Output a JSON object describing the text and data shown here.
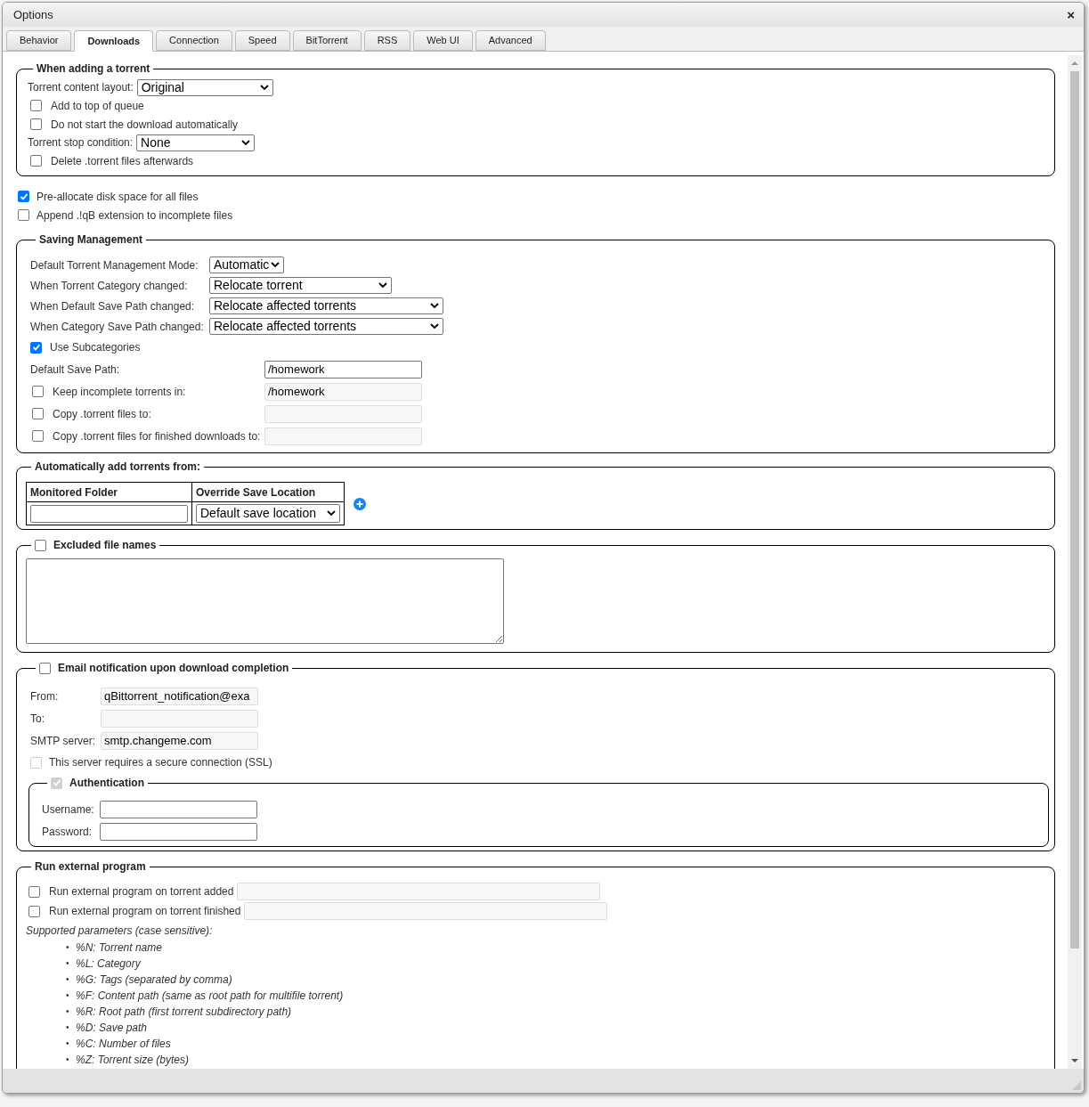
{
  "window": {
    "title": "Options",
    "close": "×"
  },
  "tabs": [
    {
      "label": "Behavior",
      "selected": false
    },
    {
      "label": "Downloads",
      "selected": true
    },
    {
      "label": "Connection",
      "selected": false
    },
    {
      "label": "Speed",
      "selected": false
    },
    {
      "label": "BitTorrent",
      "selected": false
    },
    {
      "label": "RSS",
      "selected": false
    },
    {
      "label": "Web UI",
      "selected": false
    },
    {
      "label": "Advanced",
      "selected": false
    }
  ],
  "adding": {
    "legend": "When adding a torrent",
    "rows": [
      {
        "kind": "select",
        "label": "Torrent content layout:",
        "value": "Original"
      },
      {
        "kind": "checkbox",
        "label": "Add to top of queue",
        "checked": false
      },
      {
        "kind": "checkbox",
        "label": "Do not start the download automatically",
        "checked": false
      },
      {
        "kind": "select",
        "label": "Torrent stop condition:",
        "value": "None"
      },
      {
        "kind": "checkbox",
        "label": "Delete .torrent files afterwards",
        "checked": false
      }
    ]
  },
  "options": [
    {
      "label": "Pre-allocate disk space for all files",
      "checked": true
    },
    {
      "label": "Append .!qB extension to incomplete files",
      "checked": false
    }
  ],
  "saving": {
    "legend": "Saving Management",
    "selects": [
      {
        "label": "Default Torrent Management Mode:",
        "value": "Automatic"
      },
      {
        "label": "When Torrent Category changed:",
        "value": "Relocate torrent"
      },
      {
        "label": "When Default Save Path changed:",
        "value": "Relocate affected torrents"
      },
      {
        "label": "When Category Save Path changed:",
        "value": "Relocate affected torrents"
      }
    ],
    "subcategories": {
      "label": "Use Subcategories",
      "checked": true
    },
    "paths": [
      {
        "kind": "label",
        "label": "Default Save Path:",
        "value": "/homework",
        "disabled": false
      },
      {
        "kind": "checkbox",
        "label": "Keep incomplete torrents in:",
        "checked": false,
        "value": "/homework",
        "disabled": true
      },
      {
        "kind": "checkbox",
        "label": "Copy .torrent files to:",
        "checked": false,
        "disabled": true
      },
      {
        "kind": "checkbox",
        "label": "Copy .torrent files for finished downloads to:",
        "checked": false,
        "disabled": true
      }
    ]
  },
  "watched": {
    "legend": "Automatically add torrents from:",
    "columns": [
      "Monitored Folder",
      "Override Save Location"
    ],
    "location": "Default save location"
  },
  "excluded": {
    "legend": "Excluded file names",
    "checked": false
  },
  "email": {
    "legend": "Email notification upon download completion",
    "checked": false,
    "fields": [
      {
        "label": "From:",
        "value": "qBittorrent_notification@exa",
        "disabled": true
      },
      {
        "label": "To:",
        "disabled": true
      },
      {
        "label": "SMTP server:",
        "value": "smtp.changeme.com",
        "disabled": true
      }
    ],
    "ssl": {
      "label": "This server requires a secure connection (SSL)",
      "checked": false,
      "disabled": true
    },
    "auth": {
      "legend": "Authentication",
      "checked": true,
      "disabled": true,
      "fields": [
        {
          "label": "Username:"
        },
        {
          "label": "Password:"
        }
      ]
    }
  },
  "external": {
    "legend": "Run external program",
    "rows": [
      {
        "label": "Run external program on torrent added",
        "checked": false
      },
      {
        "label": "Run external program on torrent finished",
        "checked": false
      }
    ],
    "note": "Supported parameters (case sensitive):",
    "bullet": "•",
    "params": [
      "%N: Torrent name",
      "%L: Category",
      "%G: Tags (separated by comma)",
      "%F: Content path (same as root path for multifile torrent)",
      "%R: Root path (first torrent subdirectory path)",
      "%D: Save path",
      "%C: Number of files",
      "%Z: Torrent size (bytes)"
    ]
  }
}
